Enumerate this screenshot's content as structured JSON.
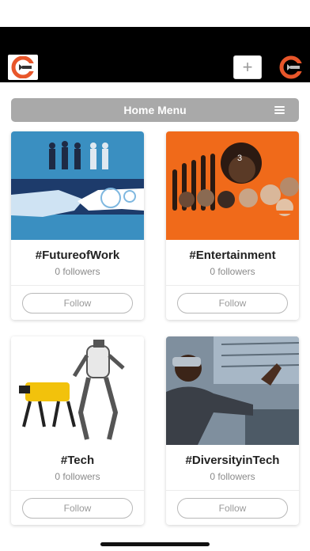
{
  "header": {
    "logo_icon": "c-logo-icon",
    "add_label": "+",
    "brand_icon": "c-brand-icon",
    "brand_color": "#e8562a"
  },
  "home_menu": {
    "label": "Home Menu",
    "menu_icon": "hamburger-icon"
  },
  "cards": [
    {
      "title": "#FutureofWork",
      "followers": "0 followers",
      "follow_label": "Follow",
      "image": "robot-handshake-illustration"
    },
    {
      "title": "#Entertainment",
      "followers": "0 followers",
      "follow_label": "Follow",
      "image": "celebrity-collage"
    },
    {
      "title": "#Tech",
      "followers": "0 followers",
      "follow_label": "Follow",
      "image": "robots-photo"
    },
    {
      "title": "#DiversityinTech",
      "followers": "0 followers",
      "follow_label": "Follow",
      "image": "vr-headset-person"
    }
  ]
}
